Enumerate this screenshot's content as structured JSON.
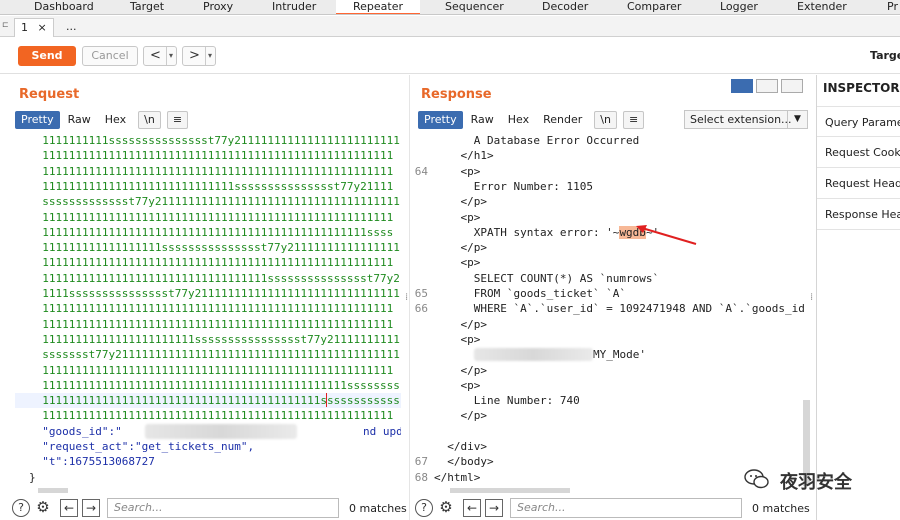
{
  "tool_tabs": [
    "Dashboard",
    "Target",
    "Proxy",
    "Intruder",
    "Repeater",
    "Sequencer",
    "Decoder",
    "Comparer",
    "Logger",
    "Extender",
    "Pr"
  ],
  "active_tool_tab": "Repeater",
  "sub_tabs": [
    {
      "label": "1",
      "close": "×"
    },
    {
      "label": "..."
    }
  ],
  "toolbar": {
    "send": "Send",
    "cancel": "Cancel",
    "back_arrow": "<",
    "fwd_arrow": ">",
    "dropdown": "▾",
    "target": "Targe"
  },
  "request": {
    "title": "Request",
    "views": [
      "Pretty",
      "Raw",
      "Hex"
    ],
    "newline_btn": "\\n",
    "menu_btn": "≡",
    "lines": [
      {
        "kind": "green",
        "text": "  1111111111ssssssssssssssst77y2111111111111111111111111"
      },
      {
        "kind": "green",
        "text": "  11111111111111111111111111111111111111111111111111111"
      },
      {
        "kind": "green",
        "text": "  11111111111111111111111111111111111111111111111111111"
      },
      {
        "kind": "green",
        "text": "  11111111111111111111111111111ssssssssssssssst77y21111"
      },
      {
        "kind": "green",
        "text": "  ssssssssssssst77y21111111111111111111111111111111111111"
      },
      {
        "kind": "green",
        "text": "  11111111111111111111111111111111111111111111111111111"
      },
      {
        "kind": "green",
        "text": "  1111111111111111111111111111111111111111111111111ssss"
      },
      {
        "kind": "green",
        "text": "  111111111111111111ssssssssssssssst77y21111111111111111"
      },
      {
        "kind": "green",
        "text": "  11111111111111111111111111111111111111111111111111111"
      },
      {
        "kind": "green",
        "text": "  1111111111111111111111111111111111ssssssssssssssst77y2"
      },
      {
        "kind": "green",
        "text": "  1111ssssssssssssssst77y211111111111111111111111111111111"
      },
      {
        "kind": "green",
        "text": "  11111111111111111111111111111111111111111111111111111"
      },
      {
        "kind": "green",
        "text": "  11111111111111111111111111111111111111111111111111111"
      },
      {
        "kind": "green",
        "text": "  11111111111111111111111sssssssssssssssst77y21111111111"
      },
      {
        "kind": "green",
        "text": "  ssssssst77y2111111111111111111111111111111111111111111"
      },
      {
        "kind": "green",
        "text": "  11111111111111111111111111111111111111111111111111111"
      },
      {
        "kind": "green",
        "text": "  1111111111111111111111111111111111111111111111sssssssss"
      },
      {
        "kind": "green",
        "text": "  111111111111111111111111111111111111111111ssssssssssss"
      },
      {
        "kind": "green",
        "text": "  11111111111111111111111111111111111111111111111111111"
      },
      {
        "kind": "blue",
        "text": "  \"goods_id\":\"",
        "tail": "nd upd"
      },
      {
        "kind": "blue",
        "text": "  \"request_act\":\"get_tickets_num\","
      },
      {
        "kind": "blue",
        "text": "  \"t\":1675513068727"
      },
      {
        "kind": "dark",
        "text": "}"
      }
    ],
    "search_placeholder": "Search...",
    "matches": "0 matches"
  },
  "response": {
    "title": "Response",
    "views": [
      "Pretty",
      "Raw",
      "Hex",
      "Render"
    ],
    "newline_btn": "\\n",
    "menu_btn": "≡",
    "select_extension": "Select extension...",
    "lines": [
      {
        "num": "",
        "text": "      A Database Error Occurred"
      },
      {
        "num": "",
        "text": "    </h1>"
      },
      {
        "num": "64",
        "text": "    <p>"
      },
      {
        "num": "",
        "text": "      Error Number: 1105"
      },
      {
        "num": "",
        "text": "    </p>"
      },
      {
        "num": "",
        "text": "    <p>"
      },
      {
        "num": "",
        "text": "      XPATH syntax error: '~",
        "hl": "wgdb",
        "after": "~'"
      },
      {
        "num": "",
        "text": "    </p>"
      },
      {
        "num": "",
        "text": "    <p>"
      },
      {
        "num": "",
        "text": "      SELECT COUNT(*) AS `numrows`"
      },
      {
        "num": "65",
        "text": "      FROM `goods_ticket` `A`"
      },
      {
        "num": "66",
        "text": "      WHERE `A`.`user_id` = 1092471948 AND `A`.`goods_id"
      },
      {
        "num": "",
        "text": "    </p>"
      },
      {
        "num": "",
        "text": "    <p>"
      },
      {
        "num": "",
        "text": "      ",
        "blur": "                  ",
        "after": "MY_Mode'"
      },
      {
        "num": "",
        "text": "    </p>"
      },
      {
        "num": "",
        "text": "    <p>"
      },
      {
        "num": "",
        "text": "      Line Number: 740"
      },
      {
        "num": "",
        "text": "    </p>"
      },
      {
        "num": "",
        "text": ""
      },
      {
        "num": "",
        "text": "  </div>"
      },
      {
        "num": "67",
        "text": "  </body>"
      },
      {
        "num": "68",
        "text": "</html>"
      }
    ],
    "search_placeholder": "Search...",
    "matches": "0 matches"
  },
  "inspector": {
    "title": "INSPECTOR",
    "items": [
      "Query Parameters",
      "Request Cookies",
      "Request Headers",
      "Response Headers"
    ]
  },
  "bottom_icons": {
    "help": "?",
    "settings": "⚙",
    "prev": "←",
    "next": "→"
  },
  "watermark": "夜羽安全",
  "colors": {
    "accent": "#f26522",
    "active_view": "#3b6cb0",
    "green_text": "#1e8a1e",
    "key_blue": "#1c2fa8",
    "title_orange": "#e8692a"
  }
}
